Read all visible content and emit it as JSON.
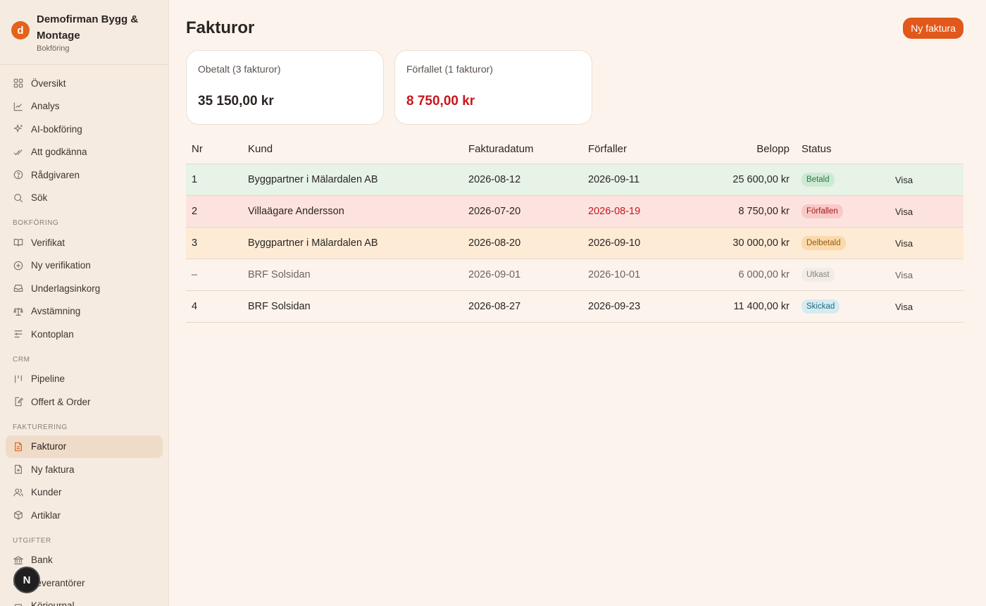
{
  "brand": {
    "logo_letter": "d",
    "name": "Demofirman Bygg & Montage",
    "subtitle": "Bokföring"
  },
  "sidebar": {
    "top_items": [
      {
        "label": "Översikt",
        "icon": "grid-icon"
      },
      {
        "label": "Analys",
        "icon": "chart-line-icon"
      },
      {
        "label": "AI-bokföring",
        "icon": "sparkles-icon"
      },
      {
        "label": "Att godkänna",
        "icon": "double-check-icon"
      },
      {
        "label": "Rådgivaren",
        "icon": "help-circle-icon"
      },
      {
        "label": "Sök",
        "icon": "search-icon"
      }
    ],
    "sections": [
      {
        "title": "BOKFÖRING",
        "items": [
          {
            "label": "Verifikat",
            "icon": "book-icon"
          },
          {
            "label": "Ny verifikation",
            "icon": "plus-circle-icon"
          },
          {
            "label": "Underlagsinkorg",
            "icon": "inbox-icon"
          },
          {
            "label": "Avstämning",
            "icon": "scale-icon"
          },
          {
            "label": "Kontoplan",
            "icon": "list-icon"
          }
        ]
      },
      {
        "title": "CRM",
        "items": [
          {
            "label": "Pipeline",
            "icon": "pipeline-icon"
          },
          {
            "label": "Offert & Order",
            "icon": "file-edit-icon"
          }
        ]
      },
      {
        "title": "FAKTURERING",
        "items": [
          {
            "label": "Fakturor",
            "icon": "invoice-icon",
            "active": true
          },
          {
            "label": "Ny faktura",
            "icon": "file-plus-icon"
          },
          {
            "label": "Kunder",
            "icon": "users-icon"
          },
          {
            "label": "Artiklar",
            "icon": "package-icon"
          }
        ]
      },
      {
        "title": "UTGIFTER",
        "items": [
          {
            "label": "Bank",
            "icon": "bank-icon"
          },
          {
            "label": "Leverantörer",
            "icon": "truck-icon"
          },
          {
            "label": "Körjournal",
            "icon": "car-icon"
          }
        ]
      }
    ],
    "floating_badge": "N"
  },
  "header": {
    "title": "Fakturor",
    "new_button": "Ny faktura"
  },
  "cards": [
    {
      "label": "Obetalt (3 fakturor)",
      "value": "35 150,00 kr",
      "overdue": false
    },
    {
      "label": "Förfallet (1 fakturor)",
      "value": "8 750,00 kr",
      "overdue": true
    }
  ],
  "table": {
    "columns": [
      "Nr",
      "Kund",
      "Fakturadatum",
      "Förfaller",
      "Belopp",
      "Status"
    ],
    "rows": [
      {
        "nr": "1",
        "kund": "Byggpartner i Mälardalen AB",
        "fakturadatum": "2026-08-12",
        "forfaller": "2026-09-11",
        "belopp": "25 600,00 kr",
        "status": "Betald",
        "action": "Visa"
      },
      {
        "nr": "2",
        "kund": "Villaägare Andersson",
        "fakturadatum": "2026-07-20",
        "forfaller": "2026-08-19",
        "belopp": "8 750,00 kr",
        "status": "Förfallen",
        "action": "Visa"
      },
      {
        "nr": "3",
        "kund": "Byggpartner i Mälardalen AB",
        "fakturadatum": "2026-08-20",
        "forfaller": "2026-09-10",
        "belopp": "30 000,00 kr",
        "status": "Delbetald",
        "action": "Visa"
      },
      {
        "nr": "–",
        "kund": "BRF Solsidan",
        "fakturadatum": "2026-09-01",
        "forfaller": "2026-10-01",
        "belopp": "6 000,00 kr",
        "status": "Utkast",
        "action": "Visa"
      },
      {
        "nr": "4",
        "kund": "BRF Solsidan",
        "fakturadatum": "2026-08-27",
        "forfaller": "2026-09-23",
        "belopp": "11 400,00 kr",
        "status": "Skickad",
        "action": "Visa"
      }
    ]
  },
  "colors": {
    "accent": "#e1581a",
    "overdue_text": "#c8161e",
    "background": "#fcf4ec",
    "sidebar": "#f5ebe0"
  }
}
